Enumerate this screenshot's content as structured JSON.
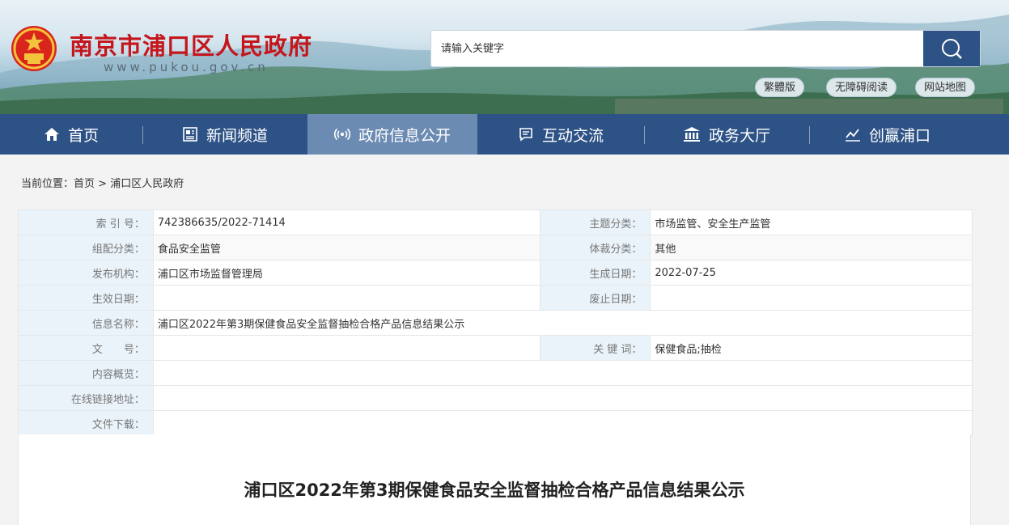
{
  "header": {
    "site_title": "南京市浦口区人民政府",
    "site_url": "www.pukou.gov.cn",
    "search_placeholder": "请输入关键字",
    "links": [
      "繁體版",
      "无障碍阅读",
      "网站地图"
    ]
  },
  "nav": {
    "items": [
      {
        "label": "首页",
        "icon": "home-icon"
      },
      {
        "label": "新闻频道",
        "icon": "newspaper-icon"
      },
      {
        "label": "政府信息公开",
        "icon": "broadcast-icon"
      },
      {
        "label": "互动交流",
        "icon": "chat-icon"
      },
      {
        "label": "政务大厅",
        "icon": "building-icon"
      },
      {
        "label": "创赢浦口",
        "icon": "chart-icon"
      }
    ],
    "active": "政府信息公开"
  },
  "breadcrumb": {
    "prefix": "当前位置：",
    "home": "首页",
    "sep": ">",
    "current": "浦口区人民政府"
  },
  "info": {
    "index_label": "索 引 号：",
    "index_value": "742386635/2022-71414",
    "topic_label": "主题分类：",
    "topic_value": "市场监管、安全生产监管",
    "category_label": "组配分类：",
    "category_value": "食品安全监管",
    "genre_label": "体裁分类：",
    "genre_value": "其他",
    "publisher_label": "发布机构：",
    "publisher_value": "浦口区市场监督管理局",
    "created_label": "生成日期：",
    "created_value": "2022-07-25",
    "effective_label": "生效日期：",
    "effective_value": "",
    "expire_label": "废止日期：",
    "expire_value": "",
    "name_label": "信息名称：",
    "name_value": "浦口区2022年第3期保健食品安全监督抽检合格产品信息结果公示",
    "docno_label": "文　　号：",
    "docno_value": "",
    "keywords_label": "关 键 词：",
    "keywords_value": "保健食品;抽检",
    "summary_label": "内容概览：",
    "summary_value": "",
    "link_label": "在线链接地址：",
    "link_value": "",
    "download_label": "文件下载：",
    "download_value": ""
  },
  "content": {
    "title": "浦口区2022年第3期保健食品安全监督抽检合格产品信息结果公示"
  },
  "colors": {
    "nav_bg": "#2d5286",
    "nav_active": "#6c8bb3",
    "title_red": "#c4161c",
    "label_bg": "#eaf3fa"
  }
}
